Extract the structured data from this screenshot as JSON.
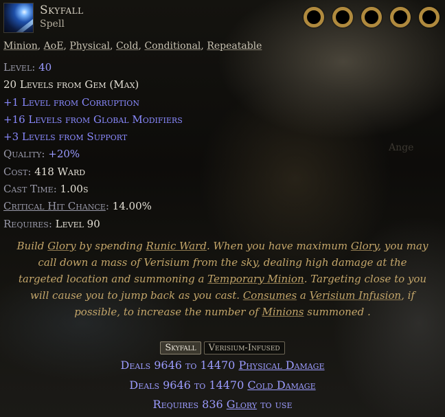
{
  "gem": {
    "name": "Skyfall",
    "type": "Spell",
    "icon": "skyfall-gem-icon",
    "sockets": 5,
    "socket_color": "#b08a3e"
  },
  "tags": [
    "Minion",
    "AoE",
    "Physical",
    "Cold",
    "Conditional",
    "Repeatable"
  ],
  "stats": {
    "level_label": "Level",
    "level_value": "40",
    "levels_from_gem": "20 Levels from Gem (Max)",
    "corruption": "+1 Level from Corruption",
    "global_modifiers": "+16 Levels from Global Modifiers",
    "support": "+3 Levels from Support",
    "quality_label": "Quality",
    "quality_value": "+20%",
    "cost_label": "Cost",
    "cost_value": "418 Ward",
    "cast_time_label": "Cast Time",
    "cast_time_value": "1.00s",
    "crit_label": "Critical Hit Chance",
    "crit_value": "14.00%",
    "requires_label": "Requires",
    "requires_value": "Level 90"
  },
  "description": {
    "p1": "Build ",
    "k1": "Glory",
    "p2": " by spending ",
    "k2": "Runic Ward",
    "p3": ". When you have maximum ",
    "k3": "Glory",
    "p4": ", you may call down a mass of Verisium from the sky, dealing high damage at the targeted location and summoning a ",
    "k4": "Temporary Minion",
    "p5": ". Targeting close to you will cause you to jump back as you cast. ",
    "k5": "Consumes",
    "p6": " a ",
    "k6": "Verisium Infusion",
    "p7": ", if possible, to increase the number of ",
    "k7": "Minions",
    "p8": " summoned ."
  },
  "tabs": [
    "Skyfall",
    "Verisium-Infused"
  ],
  "effects": {
    "physical_pre": "Deals 9646 to 14470 ",
    "physical_kw": "Physical Damage",
    "cold_pre": "Deals 9646 to 14470 ",
    "cold_kw": "Cold Damage",
    "glory_pre": "Requires 836 ",
    "glory_kw": "Glory",
    "glory_post": " to use"
  },
  "colors": {
    "magic": "#8a8aff",
    "flavour": "#c4a66a",
    "label": "#9a9aaa",
    "white": "#e4e0d6"
  }
}
